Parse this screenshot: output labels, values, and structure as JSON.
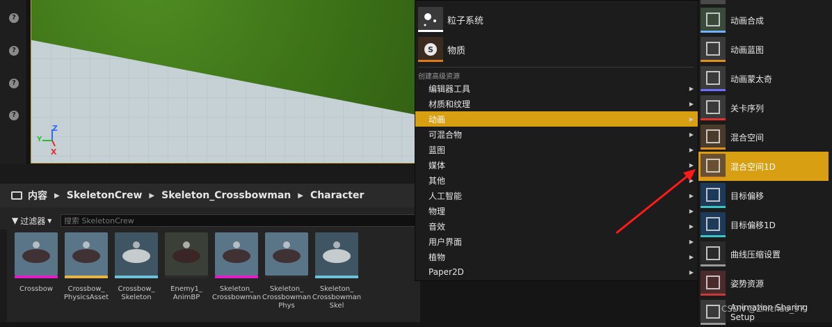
{
  "viewport": {
    "axis_z": "Z",
    "axis_y": "Y",
    "axis_x": "X"
  },
  "content_browser": {
    "breadcrumb": [
      "内容",
      "SkeletonCrew",
      "Skeleton_Crossbowman",
      "Character"
    ],
    "filter_label": "过滤器",
    "search_placeholder": "搜索 SkeletonCrew",
    "assets": [
      {
        "label": "Crossbow",
        "strip_color": "#e01ec8"
      },
      {
        "label": "Crossbow_ PhysicsAsset",
        "strip_color": "#e6b54a"
      },
      {
        "label": "Crossbow_ Skeleton",
        "strip_color": "#6ec1d8"
      },
      {
        "label": "Enemy1_ AnimBP",
        "strip_color": "#2a2a2a"
      },
      {
        "label": "Skeleton_ Crossbowman",
        "strip_color": "#e01ec8"
      },
      {
        "label": "Skeleton_ Crossbowman Phys",
        "strip_color": "#2a2a2a"
      },
      {
        "label": "Skeleton_ Crossbowman Skel",
        "strip_color": "#6ec1d8"
      }
    ]
  },
  "menu": {
    "top_items": [
      {
        "label": "粒子系统",
        "bar_color": "#ffffff"
      },
      {
        "label": "物质",
        "bar_color": "#e07a1a"
      }
    ],
    "section_label": "创建高级资源",
    "items": [
      {
        "label": "编辑器工具"
      },
      {
        "label": "材质和纹理"
      },
      {
        "label": "动画"
      },
      {
        "label": "可混合物"
      },
      {
        "label": "蓝图"
      },
      {
        "label": "媒体"
      },
      {
        "label": "其他"
      },
      {
        "label": "人工智能"
      },
      {
        "label": "物理"
      },
      {
        "label": "音效"
      },
      {
        "label": "用户界面"
      },
      {
        "label": "植物"
      },
      {
        "label": "Paper2D"
      }
    ],
    "highlighted_item": "动画"
  },
  "submenu": {
    "items": [
      {
        "label": "动画合成",
        "bar_color": "#6fb3ff"
      },
      {
        "label": "动画蓝图",
        "bar_color": "#e0901e"
      },
      {
        "label": "动画蒙太奇",
        "bar_color": "#6f6fff"
      },
      {
        "label": "关卡序列",
        "bar_color": "#e03030"
      },
      {
        "label": "混合空间",
        "bar_color": "#e0901e"
      },
      {
        "label": "混合空间1D",
        "bar_color": "#e0901e"
      },
      {
        "label": "目标偏移",
        "bar_color": "#3ac6c6"
      },
      {
        "label": "目标偏移1D",
        "bar_color": "#3ac6c6"
      },
      {
        "label": "曲线压缩设置",
        "bar_color": "#9a9a9a"
      },
      {
        "label": "姿势资源",
        "bar_color": "#c83a3a"
      },
      {
        "label": "Animation Sharing Setup",
        "bar_color": "#9a9a9a"
      }
    ],
    "highlighted_item": "混合空间1D"
  },
  "watermark": "CSDN @Zhichao_97",
  "colors": {
    "highlight": "#d89f13",
    "arrow": "#ff1a1a"
  }
}
